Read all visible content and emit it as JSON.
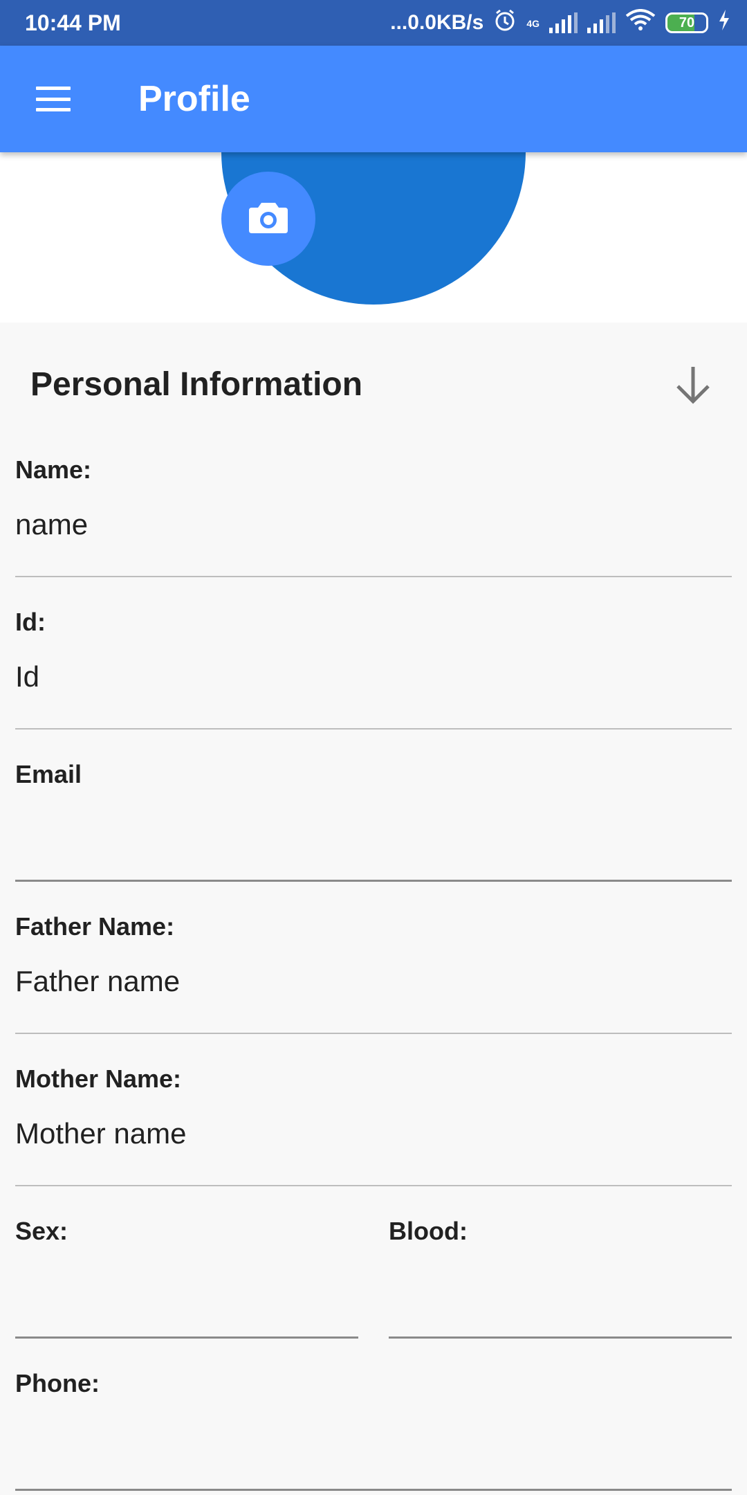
{
  "status_bar": {
    "time": "10:44 PM",
    "speed": "...0.0KB/s",
    "network": "4G",
    "battery": "70"
  },
  "app_bar": {
    "title": "Profile"
  },
  "section": {
    "title": "Personal Information"
  },
  "fields": {
    "name": {
      "label": "Name:",
      "value": "name"
    },
    "id": {
      "label": "Id:",
      "value": "Id"
    },
    "email": {
      "label": "Email",
      "value": ""
    },
    "father": {
      "label": "Father Name:",
      "value": "Father name"
    },
    "mother": {
      "label": "Mother Name:",
      "value": "Mother name"
    },
    "sex": {
      "label": "Sex:",
      "value": ""
    },
    "blood": {
      "label": "Blood:",
      "value": ""
    },
    "phone": {
      "label": "Phone:",
      "value": ""
    }
  },
  "colors": {
    "status_bar": "#2f5fb3",
    "app_bar": "#448aff",
    "avatar": "#1976d2",
    "camera_button": "#448aff"
  }
}
